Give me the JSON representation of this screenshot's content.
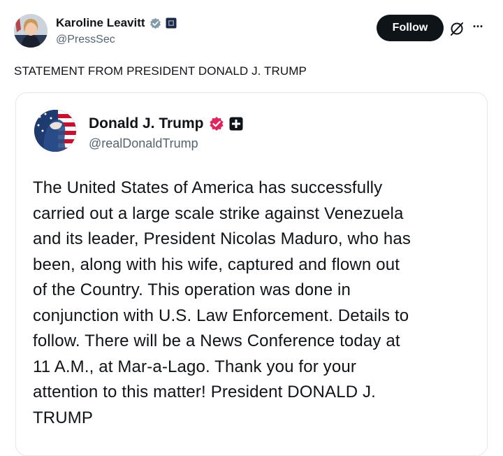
{
  "post": {
    "author": {
      "display_name": "Karoline Leavitt",
      "handle": "@PressSec",
      "avatar_icon": "profile-photo-avatar",
      "verified_badge_icon": "verified-badge-icon",
      "affiliate_badge_icon": "government-affiliate-badge-icon"
    },
    "actions": {
      "follow_label": "Follow",
      "grok_icon": "grok-icon",
      "more_icon": "more-options-icon",
      "more_label": "···"
    },
    "text": "STATEMENT FROM PRESIDENT DONALD J. TRUMP"
  },
  "quote": {
    "author": {
      "display_name": "Donald J. Trump",
      "handle": "@realDonaldTrump",
      "avatar_icon": "profile-photo-avatar",
      "verified_badge_icon": "verified-badge-icon",
      "affiliate_badge_icon": "affiliate-badge-icon"
    },
    "body_lines": [
      "The United States of America has successfully",
      "carried out a large scale strike against Venezuela",
      "and its leader, President Nicolas Maduro, who has",
      "been, along with his wife, captured and flown out",
      "of the Country. This operation was done in",
      "conjunction with U.S. Law Enforcement. Details to",
      "follow. There will be a News Conference today at",
      "11 A.M., at Mar-a-Lago. Thank you for your",
      "attention to this matter! President DONALD J.",
      "TRUMP"
    ]
  },
  "colors": {
    "text_primary": "#0f1419",
    "text_secondary": "#536471",
    "verified_blue": "#1d9bf0",
    "verified_red": "#e0245e",
    "follow_bg": "#0f1419",
    "card_border": "#e4e7ea"
  }
}
